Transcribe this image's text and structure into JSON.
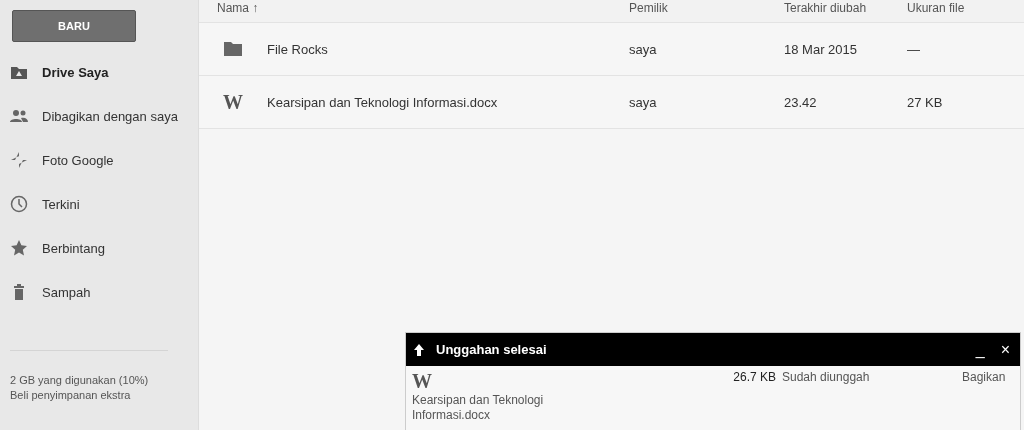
{
  "sidebar": {
    "new_button": "BARU",
    "items": [
      {
        "label": "Drive Saya",
        "kind": "drive",
        "selected": true
      },
      {
        "label": "Dibagikan dengan saya",
        "kind": "shared",
        "selected": false
      },
      {
        "label": "Foto Google",
        "kind": "photos",
        "selected": false
      },
      {
        "label": "Terkini",
        "kind": "recent",
        "selected": false
      },
      {
        "label": "Berbintang",
        "kind": "starred",
        "selected": false
      },
      {
        "label": "Sampah",
        "kind": "trash",
        "selected": false
      }
    ],
    "storage": "2 GB yang digunakan (10%)",
    "buy_link": "Beli penyimpanan ekstra"
  },
  "table": {
    "columns": [
      "Nama ↑",
      "Pemilik",
      "Terakhir diubah",
      "Ukuran file"
    ],
    "rows": [
      {
        "kind": "folder",
        "name": "File Rocks",
        "owner": "saya",
        "modified": "18 Mar 2015",
        "size": "—"
      },
      {
        "kind": "doc",
        "icon_text": "W",
        "name": "Kearsipan dan Teknologi Informasi.docx",
        "owner": "saya",
        "modified": "23.42",
        "size": "27 KB"
      }
    ]
  },
  "upload_panel": {
    "title": "Unggahan selesai",
    "minimize": "_",
    "close": "×",
    "items": [
      {
        "icon_text": "W",
        "name": "Kearsipan dan Teknologi Informasi.docx",
        "size": "26.7 KB",
        "status": "Sudah diunggah",
        "action": "Bagikan"
      }
    ]
  }
}
